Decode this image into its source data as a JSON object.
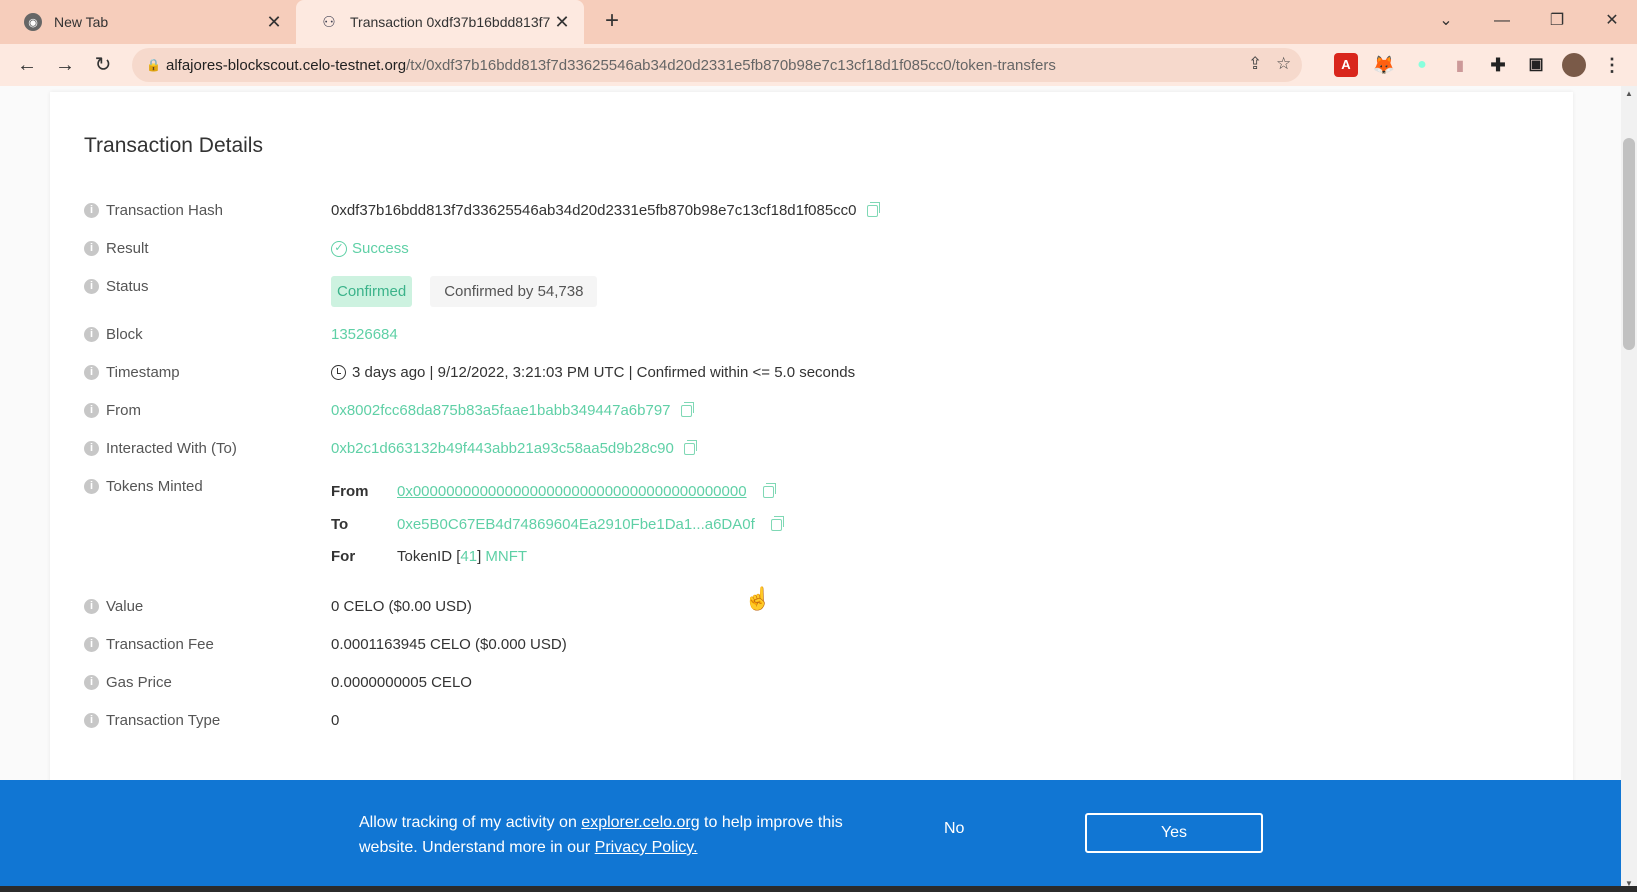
{
  "browser": {
    "tabs": [
      {
        "title": "New Tab",
        "favicon": "chrome-icon"
      },
      {
        "title": "Transaction 0xdf37b16bdd813f7",
        "favicon": "blockscout-icon"
      }
    ],
    "new_tab_label": "+",
    "url_host": "alfajores-blockscout.celo-testnet.org",
    "url_path": "/tx/0xdf37b16bdd813f7d33625546ab34d20d2331e5fb870b98e7c13cf18d1f085cc0/token-transfers",
    "extensions": [
      "acrobat-icon",
      "metamask-icon",
      "extension-icon",
      "extension-icon",
      "puzzle-icon",
      "sidebar-icon",
      "profile-avatar"
    ]
  },
  "page": {
    "title": "Transaction Details",
    "fields": {
      "hash": {
        "label": "Transaction Hash",
        "value": "0xdf37b16bdd813f7d33625546ab34d20d2331e5fb870b98e7c13cf18d1f085cc0"
      },
      "result": {
        "label": "Result",
        "value": "Success"
      },
      "status": {
        "label": "Status",
        "badge": "Confirmed",
        "confirmations": "Confirmed by 54,738"
      },
      "block": {
        "label": "Block",
        "value": "13526684"
      },
      "timestamp": {
        "label": "Timestamp",
        "value": "3 days ago | 9/12/2022, 3:21:03 PM UTC | Confirmed within <= 5.0 seconds"
      },
      "from": {
        "label": "From",
        "value": "0x8002fcc68da875b83a5faae1babb349447a6b797"
      },
      "to": {
        "label": "Interacted With (To)",
        "value": "0xb2c1d663132b49f443abb21a93c58aa5d9b28c90"
      },
      "tokens_minted": {
        "label": "Tokens Minted",
        "from_key": "From",
        "from_value": "0x0000000000000000000000000000000000000000",
        "to_key": "To",
        "to_value": "0xe5B0C67EB4d74869604Ea2910Fbe1Da1...a6DA0f",
        "for_key": "For",
        "token_prefix": "TokenID [",
        "token_id": "41",
        "token_suffix": "]",
        "token_name": "MNFT"
      },
      "value": {
        "label": "Value",
        "value": "0 CELO ($0.00 USD)"
      },
      "fee": {
        "label": "Transaction Fee",
        "value": "0.0001163945 CELO ($0.000 USD)"
      },
      "gas_price": {
        "label": "Gas Price",
        "value": "0.0000000005 CELO"
      },
      "tx_type": {
        "label": "Transaction Type",
        "value": "0"
      }
    }
  },
  "consent": {
    "text_before": "Allow tracking of my activity on ",
    "link_site": "explorer.celo.org",
    "text_middle": " to help improve this website. Understand more in our ",
    "link_policy": "Privacy Policy.",
    "no_label": "No",
    "yes_label": "Yes"
  },
  "colors": {
    "accent": "#5fd0a6",
    "consent_bg": "#1176d3",
    "tab_strip": "#f6cdbb"
  }
}
